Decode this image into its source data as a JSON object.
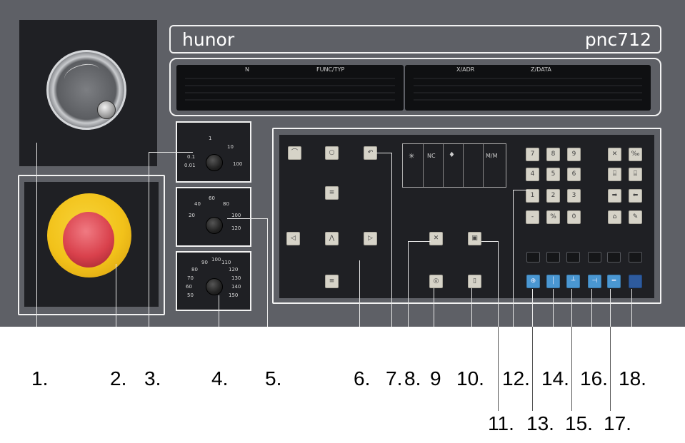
{
  "brand": {
    "left": "hunor",
    "right": "pnc712"
  },
  "display": {
    "labels": [
      "N",
      "FUNC/TYP",
      "X/ADR",
      "Z/DATA"
    ]
  },
  "keypad": {
    "digits": [
      "7",
      "8",
      "9",
      "4",
      "5",
      "6",
      "1",
      "2",
      "3",
      "-",
      "%",
      "0"
    ]
  },
  "knobs": {
    "feed_scale": [
      "0.1",
      "0.01",
      "1",
      "10",
      "100"
    ],
    "override_scale": [
      "20",
      "40",
      "60",
      "80",
      "100",
      "120"
    ],
    "spindle_scale": [
      "50",
      "60",
      "70",
      "80",
      "90",
      "100",
      "110",
      "120",
      "130",
      "140",
      "150"
    ]
  },
  "mode_panel": {
    "labels": [
      "NC",
      "M/M"
    ]
  },
  "callouts": {
    "row1": [
      "1.",
      "2.",
      "3.",
      "4.",
      "5.",
      "6.",
      "7.",
      "8.",
      "9",
      "10.",
      "12.",
      "14.",
      "16.",
      "18."
    ],
    "row2": [
      "11.",
      "13.",
      "15.",
      "17."
    ]
  },
  "colors": {
    "panel": "#5e6066",
    "key_blue": "#4a97d2",
    "emergency_red": "#d9414c",
    "emergency_yellow": "#f2c21a"
  }
}
